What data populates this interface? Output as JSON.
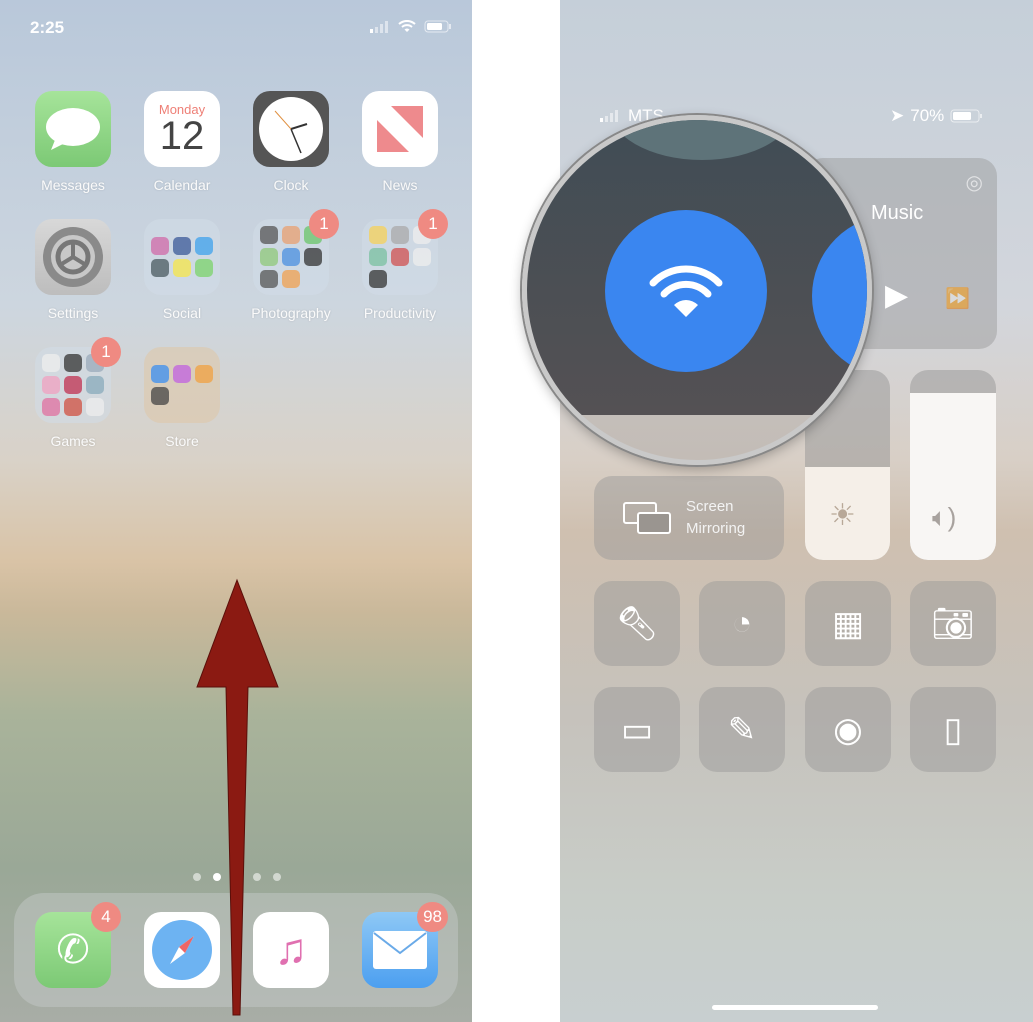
{
  "home": {
    "status": {
      "time": "2:25"
    },
    "apps": [
      {
        "label": "Messages",
        "icon": "messages-icon",
        "color": "#8fd48a"
      },
      {
        "label": "Calendar",
        "icon": "calendar-icon",
        "day": "Monday",
        "date": "12"
      },
      {
        "label": "Clock",
        "icon": "clock-icon"
      },
      {
        "label": "News",
        "icon": "news-icon",
        "color": "#ee8a8d"
      },
      {
        "label": "Settings",
        "icon": "settings-icon"
      },
      {
        "label": "Social",
        "icon": "folder-icon"
      },
      {
        "label": "Photography",
        "icon": "folder-icon",
        "badge": "1"
      },
      {
        "label": "Productivity",
        "icon": "folder-icon",
        "badge": "1"
      },
      {
        "label": "Games",
        "icon": "folder-icon",
        "badge": "1"
      },
      {
        "label": "Store",
        "icon": "folder-icon"
      }
    ],
    "page_dots": 5,
    "active_page": 2,
    "dock": [
      {
        "icon": "phone-icon",
        "badge": "4"
      },
      {
        "icon": "safari-icon"
      },
      {
        "icon": "music-icon"
      },
      {
        "icon": "mail-icon",
        "badge": "98"
      }
    ],
    "arrow_color": "#8b1a12"
  },
  "control_center": {
    "status": {
      "carrier": "MTS",
      "battery": "70%"
    },
    "music": {
      "title": "Music"
    },
    "wifi_color": "#3a86f0",
    "screen_mirroring": {
      "line1": "Screen",
      "line2": "Mirroring"
    },
    "brightness_level": 0.49,
    "volume_level": 0.88,
    "controls": [
      "flashlight-icon",
      "timer-icon",
      "calculator-icon",
      "camera-icon",
      "low-power-icon",
      "notes-icon",
      "screen-record-icon",
      "remote-icon"
    ]
  }
}
